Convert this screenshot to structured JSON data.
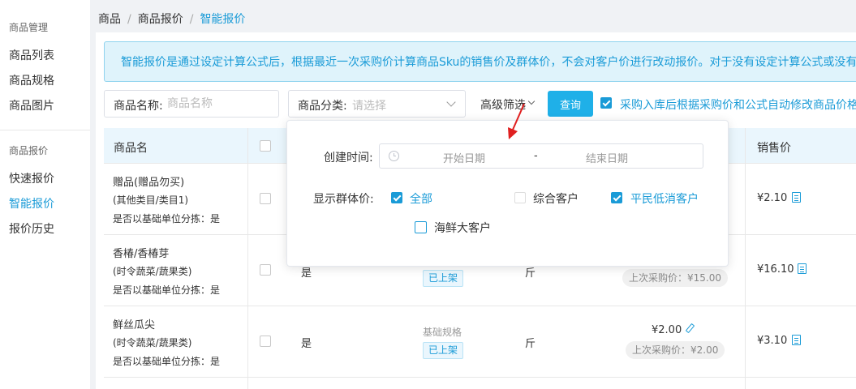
{
  "sidebar": {
    "group1": "商品管理",
    "items1": [
      "商品列表",
      "商品规格",
      "商品图片"
    ],
    "group2": "商品报价",
    "items2": [
      "快速报价",
      "智能报价",
      "报价历史"
    ]
  },
  "breadcrumb": [
    "商品",
    "商品报价",
    "智能报价"
  ],
  "notice": "智能报价是通过设定计算公式后，根据最近一次采购价计算商品Sku的销售价及群体价，不会对客户价进行改动报价。对于没有设定计算公式或没有",
  "filters": {
    "name_label": "商品名称:",
    "name_placeholder": "商品名称",
    "category_label": "商品分类:",
    "category_placeholder": "请选择",
    "advanced_label": "高级筛选",
    "query_label": "查询",
    "auto_update_label": "采购入库后根据采购价和公式自动修改商品价格"
  },
  "table": {
    "headers": {
      "name": "商品名",
      "sale_price": "销售价"
    },
    "rows": [
      {
        "name": "赠品(赠品勿买)",
        "category": "(其他类目/类目1)",
        "sort": "是否以基础单位分拣：是",
        "sale_price": "¥2.10"
      },
      {
        "name": "香椿/香椿芽",
        "category": "(时令蔬菜/蔬果类)",
        "sort": "是否以基础单位分拣：是",
        "basic": "是",
        "status": "已上架",
        "unit": "斤",
        "last_purchase": "上次采购价：¥15.00",
        "sale_price": "¥16.10"
      },
      {
        "name": "鲜丝瓜尖",
        "category": "(时令蔬菜/蔬果类)",
        "sort": "是否以基础单位分拣：是",
        "basic": "是",
        "spec": "基础规格",
        "status": "已上架",
        "unit": "斤",
        "purchase_price": "¥2.00",
        "last_purchase": "上次采购价：¥2.00",
        "sale_price": "¥3.10"
      }
    ]
  },
  "popover": {
    "created_label": "创建时间:",
    "start_placeholder": "开始日期",
    "range_sep": "-",
    "end_placeholder": "结束日期",
    "group_price_label": "显示群体价:",
    "options": [
      {
        "label": "全部",
        "checked": true
      },
      {
        "label": "综合客户",
        "checked": false
      },
      {
        "label": "平民低消客户",
        "checked": true
      },
      {
        "label": "海鲜大客户",
        "checked": false
      }
    ]
  },
  "colors": {
    "accent": "#1a9bd7",
    "button": "#1fb0e8",
    "annotation_arrow": "#e02020"
  }
}
